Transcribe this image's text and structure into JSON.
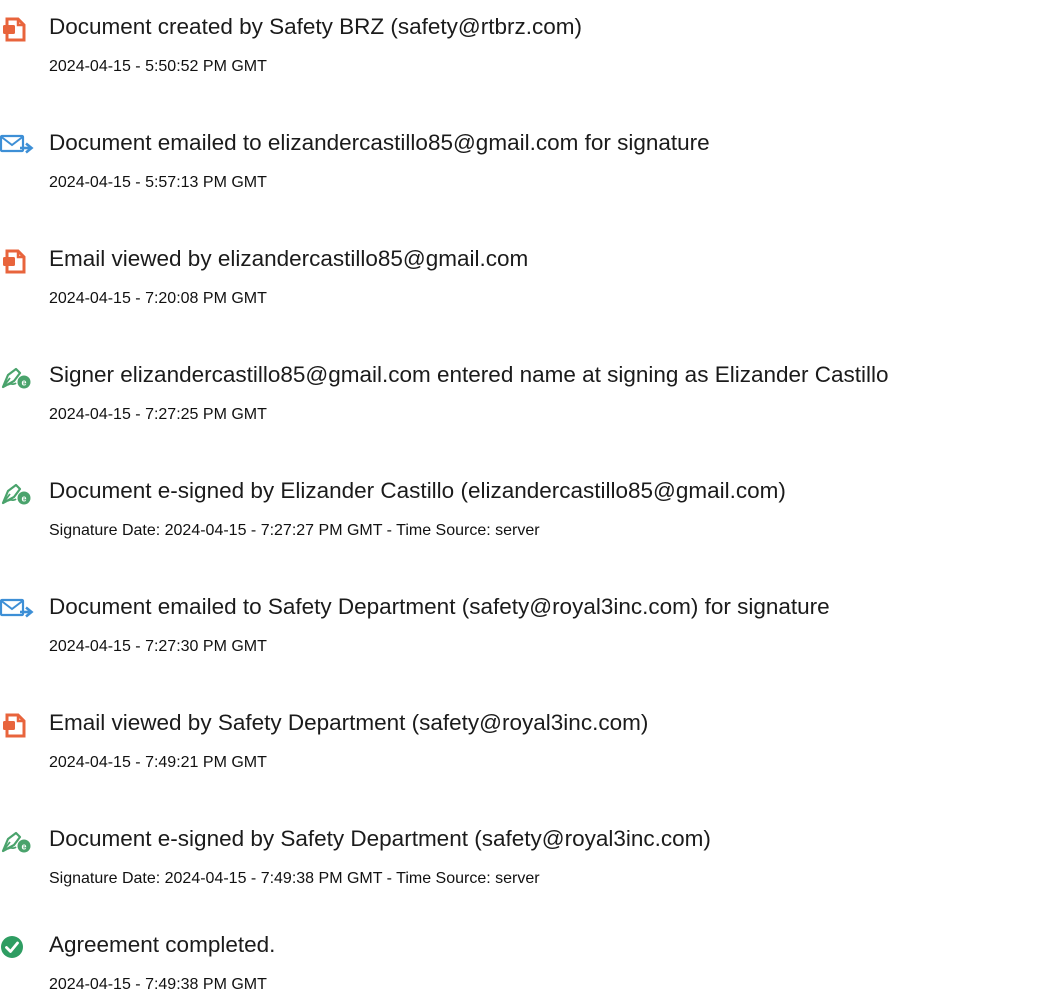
{
  "colors": {
    "document_icon": "#e8643c",
    "email_icon": "#3d8fd6",
    "sign_icon": "#4aa36c",
    "complete_icon": "#2e9d62"
  },
  "events": [
    {
      "icon": "document-icon",
      "title": "Document created by Safety BRZ (safety@rtbrz.com)",
      "time": "2024-04-15 - 5:50:52 PM GMT"
    },
    {
      "icon": "email-send-icon",
      "title": "Document emailed to elizandercastillo85@gmail.com for signature",
      "time": "2024-04-15 - 5:57:13 PM GMT"
    },
    {
      "icon": "document-icon",
      "title": "Email viewed by elizandercastillo85@gmail.com",
      "time": "2024-04-15 - 7:20:08 PM GMT"
    },
    {
      "icon": "e-sign-pen-icon",
      "title": "Signer elizandercastillo85@gmail.com entered name at signing as Elizander Castillo",
      "time": "2024-04-15 - 7:27:25 PM GMT"
    },
    {
      "icon": "e-sign-pen-icon",
      "title": "Document e-signed by Elizander Castillo (elizandercastillo85@gmail.com)",
      "time": "Signature Date: 2024-04-15 - 7:27:27 PM GMT - Time Source: server"
    },
    {
      "icon": "email-send-icon",
      "title": "Document emailed to Safety Department (safety@royal3inc.com) for signature",
      "time": "2024-04-15 - 7:27:30 PM GMT"
    },
    {
      "icon": "document-icon",
      "title": "Email viewed by Safety Department (safety@royal3inc.com)",
      "time": "2024-04-15 - 7:49:21 PM GMT"
    },
    {
      "icon": "e-sign-pen-icon",
      "title": "Document e-signed by Safety Department (safety@royal3inc.com)",
      "time": "Signature Date: 2024-04-15 - 7:49:38 PM GMT - Time Source: server"
    },
    {
      "icon": "checkmark-circle-icon",
      "title": "Agreement completed.",
      "time": "2024-04-15 - 7:49:38 PM GMT"
    }
  ]
}
